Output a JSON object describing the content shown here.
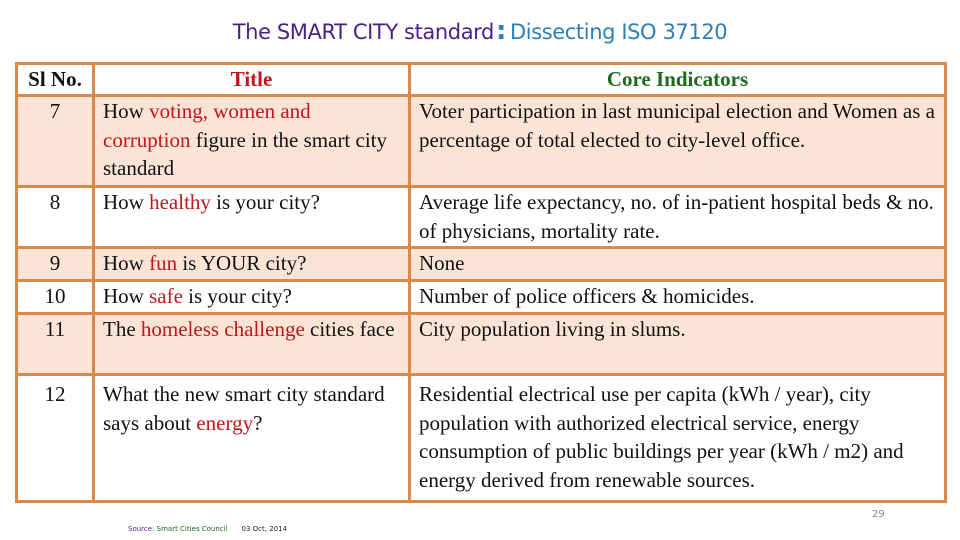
{
  "slide": {
    "title_main": "The SMART CITY  standard",
    "title_colon": ":",
    "title_sub": "Dissecting ISO 37120",
    "colors": {
      "title_main": "#4b1d8a",
      "title_sub": "#2e7fb8",
      "border": "#d9894a",
      "shade_row": "#fbe4d5",
      "highlight": "#c0161c",
      "core_header": "#1e6b1e"
    }
  },
  "table": {
    "headers": {
      "slno": "Sl No.",
      "title": "Title",
      "core": "Core Indicators"
    },
    "rows": [
      {
        "slno": "7",
        "title": {
          "pre": "How ",
          "highlight": "voting, women and corruption",
          "post": " figure in the smart city standard"
        },
        "core": "Voter participation in last municipal election and Women as a percentage of total elected to city-level office."
      },
      {
        "slno": "8",
        "title": {
          "pre": "How ",
          "highlight": "healthy",
          "post": " is your city?"
        },
        "core": "Average life expectancy, no. of in-patient hospital beds & no. of physicians, mortality rate."
      },
      {
        "slno": "9",
        "title": {
          "pre": "How ",
          "highlight": "fun",
          "post": " is YOUR city?"
        },
        "core": "None"
      },
      {
        "slno": "10",
        "title": {
          "pre": "How ",
          "highlight": "safe",
          "post": " is your city?"
        },
        "core": "Number of police officers & homicides."
      },
      {
        "slno": "11",
        "title": {
          "pre": "The ",
          "highlight": "homeless challenge",
          "post": " cities face"
        },
        "core": "City population living in slums."
      },
      {
        "slno": "12",
        "title": {
          "pre": "What the new smart city standard says about ",
          "highlight": "energy",
          "post": "?"
        },
        "core": "Residential electrical use per capita (kWh / year), city population with authorized electrical service, energy consumption of public buildings per year (kWh / m2) and energy derived from renewable sources."
      }
    ]
  },
  "footer": {
    "source_label": "Source: ",
    "source_value": "Smart Cities Council",
    "date": "03 Oct, 2014",
    "page_number": "29"
  }
}
